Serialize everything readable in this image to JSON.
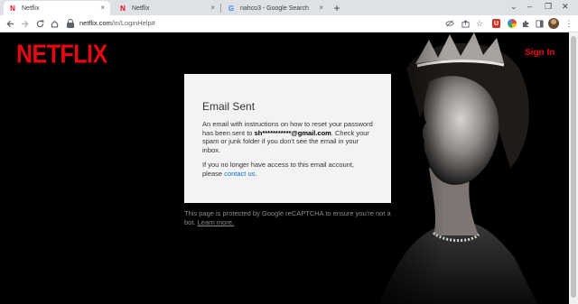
{
  "browser": {
    "tabs": [
      {
        "title": "Netflix",
        "icon": "netflix-favicon",
        "active": true
      },
      {
        "title": "Netflix",
        "icon": "netflix-favicon",
        "active": false
      },
      {
        "title": "nahco3 - Google Search",
        "icon": "google-favicon",
        "active": false
      }
    ],
    "close_glyph": "×",
    "new_tab_glyph": "+",
    "url_host": "netflix.com",
    "url_path": "/in/LoginHelp#",
    "window_controls": [
      "⌄",
      "–",
      "❐",
      "✕"
    ]
  },
  "page": {
    "logo": "NETFLIX",
    "sign_in": "Sign In",
    "card": {
      "title": "Email Sent",
      "body_pre": "An email with instructions on how to reset your password has been sent to",
      "email": "sh***********@gmail.com",
      "body_post": ". Check your spam or junk folder if you don't see the email in your inbox.",
      "access_text": "If you no longer have access to this email account, please",
      "contact_link": "contact us",
      "period": "."
    },
    "recaptcha_text": "This page is protected by Google reCAPTCHA to ensure you're not a bot.",
    "learn_more": "Learn more."
  },
  "colors": {
    "netflix_red": "#e50914",
    "link_blue": "#0071eb",
    "card_bg": "#f3f3f3",
    "page_bg": "#000000"
  }
}
